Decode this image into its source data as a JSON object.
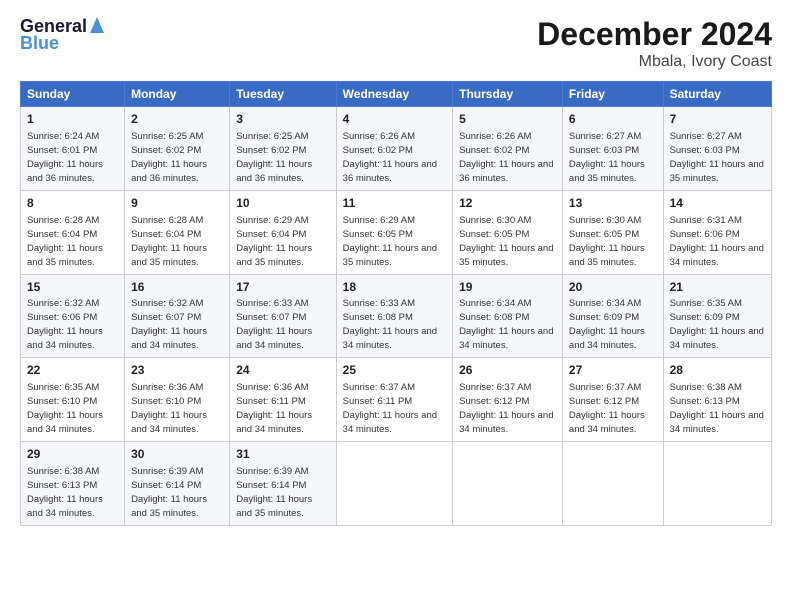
{
  "logo": {
    "line1": "General",
    "line2": "Blue"
  },
  "title": "December 2024",
  "subtitle": "Mbala, Ivory Coast",
  "days_of_week": [
    "Sunday",
    "Monday",
    "Tuesday",
    "Wednesday",
    "Thursday",
    "Friday",
    "Saturday"
  ],
  "weeks": [
    [
      {
        "day": "1",
        "sunrise": "6:24 AM",
        "sunset": "6:01 PM",
        "daylight": "11 hours and 36 minutes."
      },
      {
        "day": "2",
        "sunrise": "6:25 AM",
        "sunset": "6:02 PM",
        "daylight": "11 hours and 36 minutes."
      },
      {
        "day": "3",
        "sunrise": "6:25 AM",
        "sunset": "6:02 PM",
        "daylight": "11 hours and 36 minutes."
      },
      {
        "day": "4",
        "sunrise": "6:26 AM",
        "sunset": "6:02 PM",
        "daylight": "11 hours and 36 minutes."
      },
      {
        "day": "5",
        "sunrise": "6:26 AM",
        "sunset": "6:02 PM",
        "daylight": "11 hours and 36 minutes."
      },
      {
        "day": "6",
        "sunrise": "6:27 AM",
        "sunset": "6:03 PM",
        "daylight": "11 hours and 35 minutes."
      },
      {
        "day": "7",
        "sunrise": "6:27 AM",
        "sunset": "6:03 PM",
        "daylight": "11 hours and 35 minutes."
      }
    ],
    [
      {
        "day": "8",
        "sunrise": "6:28 AM",
        "sunset": "6:04 PM",
        "daylight": "11 hours and 35 minutes."
      },
      {
        "day": "9",
        "sunrise": "6:28 AM",
        "sunset": "6:04 PM",
        "daylight": "11 hours and 35 minutes."
      },
      {
        "day": "10",
        "sunrise": "6:29 AM",
        "sunset": "6:04 PM",
        "daylight": "11 hours and 35 minutes."
      },
      {
        "day": "11",
        "sunrise": "6:29 AM",
        "sunset": "6:05 PM",
        "daylight": "11 hours and 35 minutes."
      },
      {
        "day": "12",
        "sunrise": "6:30 AM",
        "sunset": "6:05 PM",
        "daylight": "11 hours and 35 minutes."
      },
      {
        "day": "13",
        "sunrise": "6:30 AM",
        "sunset": "6:05 PM",
        "daylight": "11 hours and 35 minutes."
      },
      {
        "day": "14",
        "sunrise": "6:31 AM",
        "sunset": "6:06 PM",
        "daylight": "11 hours and 34 minutes."
      }
    ],
    [
      {
        "day": "15",
        "sunrise": "6:32 AM",
        "sunset": "6:06 PM",
        "daylight": "11 hours and 34 minutes."
      },
      {
        "day": "16",
        "sunrise": "6:32 AM",
        "sunset": "6:07 PM",
        "daylight": "11 hours and 34 minutes."
      },
      {
        "day": "17",
        "sunrise": "6:33 AM",
        "sunset": "6:07 PM",
        "daylight": "11 hours and 34 minutes."
      },
      {
        "day": "18",
        "sunrise": "6:33 AM",
        "sunset": "6:08 PM",
        "daylight": "11 hours and 34 minutes."
      },
      {
        "day": "19",
        "sunrise": "6:34 AM",
        "sunset": "6:08 PM",
        "daylight": "11 hours and 34 minutes."
      },
      {
        "day": "20",
        "sunrise": "6:34 AM",
        "sunset": "6:09 PM",
        "daylight": "11 hours and 34 minutes."
      },
      {
        "day": "21",
        "sunrise": "6:35 AM",
        "sunset": "6:09 PM",
        "daylight": "11 hours and 34 minutes."
      }
    ],
    [
      {
        "day": "22",
        "sunrise": "6:35 AM",
        "sunset": "6:10 PM",
        "daylight": "11 hours and 34 minutes."
      },
      {
        "day": "23",
        "sunrise": "6:36 AM",
        "sunset": "6:10 PM",
        "daylight": "11 hours and 34 minutes."
      },
      {
        "day": "24",
        "sunrise": "6:36 AM",
        "sunset": "6:11 PM",
        "daylight": "11 hours and 34 minutes."
      },
      {
        "day": "25",
        "sunrise": "6:37 AM",
        "sunset": "6:11 PM",
        "daylight": "11 hours and 34 minutes."
      },
      {
        "day": "26",
        "sunrise": "6:37 AM",
        "sunset": "6:12 PM",
        "daylight": "11 hours and 34 minutes."
      },
      {
        "day": "27",
        "sunrise": "6:37 AM",
        "sunset": "6:12 PM",
        "daylight": "11 hours and 34 minutes."
      },
      {
        "day": "28",
        "sunrise": "6:38 AM",
        "sunset": "6:13 PM",
        "daylight": "11 hours and 34 minutes."
      }
    ],
    [
      {
        "day": "29",
        "sunrise": "6:38 AM",
        "sunset": "6:13 PM",
        "daylight": "11 hours and 34 minutes."
      },
      {
        "day": "30",
        "sunrise": "6:39 AM",
        "sunset": "6:14 PM",
        "daylight": "11 hours and 35 minutes."
      },
      {
        "day": "31",
        "sunrise": "6:39 AM",
        "sunset": "6:14 PM",
        "daylight": "11 hours and 35 minutes."
      },
      null,
      null,
      null,
      null
    ]
  ]
}
